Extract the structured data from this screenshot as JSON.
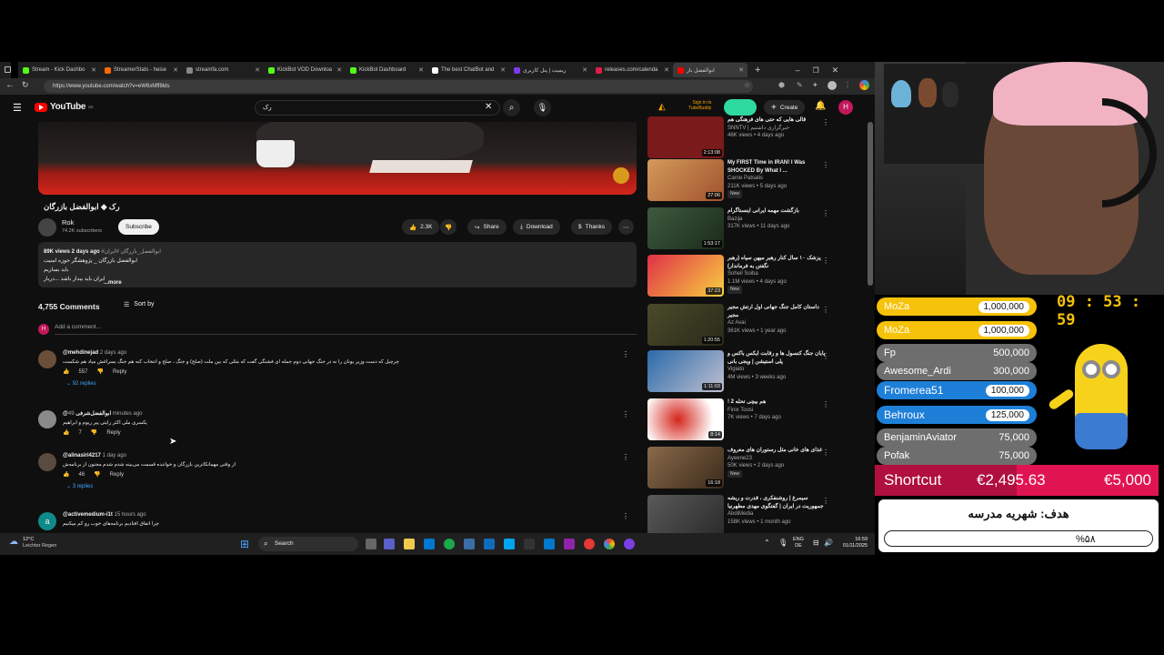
{
  "browser": {
    "tabs": [
      {
        "label": "Stream - Kick Dashbo",
        "color": "#53fc18"
      },
      {
        "label": "StreamerStats - heise",
        "color": "#ff6a00"
      },
      {
        "label": "streamfa.com",
        "color": "#888888"
      },
      {
        "label": "KickBot VOD Downloa",
        "color": "#53fc18"
      },
      {
        "label": "KickBot Dashboard",
        "color": "#53fc18"
      },
      {
        "label": "The best ChatBot and",
        "color": "#ffffff"
      },
      {
        "label": "ریمیت | پنل کاربری",
        "color": "#7c3aed"
      },
      {
        "label": "releases.com/calenda",
        "color": "#e11d48"
      },
      {
        "label": "ابوالفضل باز",
        "color": "#ff0000",
        "active": true
      }
    ],
    "url": "https://www.youtube.com/watch?v=eW6xMff8lds"
  },
  "youtube": {
    "logo_text": "YouTube",
    "logo_region": "DE",
    "search_value": "رک",
    "sign_in_lines": [
      "Sign in to",
      "TubeBuddy"
    ],
    "create_label": "Create",
    "profile_letter": "H",
    "video_title": "رک ◆ ابوالفضل بازرگان",
    "channel": {
      "name": "Rok",
      "subscribers": "74.2K subscribers",
      "subscribe_label": "Subscribe"
    },
    "actions": {
      "likes": "2.3K",
      "share": "Share",
      "download": "Download",
      "thanks": "Thanks"
    },
    "description": {
      "stats": "89K views  2 days ago",
      "tags": "#ابوالفضل_بازرگان #ایران",
      "lines": [
        "ابوالفضل بازرگان _ پژوهشگر حوزه امنیت",
        "باید بسازیم",
        "ایران باید بیدار باشد ...دربار"
      ],
      "more": "...more"
    },
    "comments": {
      "count": "4,755 Comments",
      "sort_label": "Sort by",
      "add_placeholder": "Add a comment...",
      "items": [
        {
          "author": "@mehdinejad",
          "time": "2 days ago",
          "text": "چرچیل که دست وزیر یونان را نه در جنگ جهانی دوم جمله ای فشنگی گفت که مثلی که بین ملت (صلح) و جنگ ، صلح و انتخاب کنه هم جنگ بسراغش میاد هم شکست",
          "likes": "557",
          "reply": "Reply",
          "replies": "92 replies",
          "avatar_color": "#6b4f3a"
        },
        {
          "author": "@ابوالفضل‌شرفی",
          "time": "49 minutes ago",
          "text": "یکسری ملی اکثر رایتی پیر ریوم و ابراهیم",
          "likes": "7",
          "reply": "Reply",
          "replies": "",
          "avatar_color": "#8a8a8a"
        },
        {
          "author": "@alinasiri4217",
          "time": "1 day ago",
          "text": "از وقتی مهمانکاترین بازرگان و خواننده قسمت می‌بینه شدم شدم مجنون از برنامه‌ش",
          "likes": "46",
          "reply": "Reply",
          "replies": "3 replies",
          "avatar_color": "#5a4a40"
        },
        {
          "author": "@activemedium-i1t",
          "time": "15 hours ago",
          "text": "چرا اتفاق افتادیم برنامه‌های خوب رو کم میکنیم",
          "likes": "",
          "reply": "",
          "replies": "",
          "avatar_color": "#0f8a8a"
        }
      ]
    },
    "recommendations": [
      {
        "title": "قالی هایی که حتی های فرهنگی هم",
        "channel": "SNNTV | خبرگزاری داشتیم",
        "stats": "46K views • 4 days ago",
        "duration": "2:13:08",
        "badge": "",
        "thumb": "#7a1a1a"
      },
      {
        "title": "My FIRST Time in IRAN! I Was SHOCKED By What I ...",
        "channel": "Carrie Patsalis",
        "stats": "211K views • 5 days ago",
        "duration": "27:06",
        "badge": "New",
        "thumb": "#b8753a"
      },
      {
        "title": "بازگشت مهمه ایرانی اینستاگرام",
        "channel": "Bazija",
        "stats": "317K views • 11 days ago",
        "duration": "1:53:17",
        "badge": "",
        "thumb": "#2e3e2e"
      },
      {
        "title": "پزشک ۱۰ سال کنار رهبر میهن سپاه (رهبر نگفتن به فرماندار)",
        "channel": "Soheil Soiba",
        "stats": "1.1M views • 4 days ago",
        "duration": "37:23",
        "badge": "New",
        "thumb": "#c0283a"
      },
      {
        "title": "داستان کامل جنگ جهانی اول ارتش مجیر مجیر",
        "channel": "Az Avai",
        "stats": "361K views • 1 year ago",
        "duration": "1:20:55",
        "badge": "",
        "thumb": "#3a3a22"
      },
      {
        "title": "پایان جنگ کنسول ها و رقابت ایکس باکس و پلی استیشن | ویجی بانی",
        "channel": "Vigiato",
        "stats": "4M views • 3 weeks ago",
        "duration": "1:11:03",
        "badge": "",
        "thumb": "#2a4a6a"
      },
      {
        "title": "! 2 هم بیچی تحله",
        "channel": "Finix Toosi",
        "stats": "7K views • 7 days ago",
        "duration": "8:14",
        "badge": "",
        "thumb": "#c7261c"
      },
      {
        "title": "غذای های خانی مثل رستوران های معروف",
        "channel": "Ayeene23",
        "stats": "50K views • 2 days ago",
        "duration": "16:18",
        "badge": "New",
        "thumb": "#6a4a3a"
      },
      {
        "title": "سیمرغ | روشنفکری ، قدرت و ریشه جمهوریت در ایران | گفتگوی مهدی مطهرنیا",
        "channel": "AbdiMedia",
        "stats": "158K views • 1 month ago",
        "duration": "",
        "badge": "",
        "thumb": "#3a3a3a"
      }
    ]
  },
  "taskbar": {
    "weather_temp": "12°C",
    "weather_desc": "Leichter Regen",
    "search_label": "Search",
    "lang_top": "ENG",
    "lang_bottom": "DE",
    "time": "16:59",
    "date": "01/11/2025"
  },
  "overlay": {
    "timer": "09 : 53 : 59",
    "leaderboard": [
      {
        "name": "MoZa",
        "amount": "1,000,000",
        "style": "gold"
      },
      {
        "name": "MoZa",
        "amount": "1,000,000",
        "style": "gold"
      },
      {
        "name": "Fp",
        "amount": "500,000",
        "style": "gray"
      },
      {
        "name": "Awesome_Ardi",
        "amount": "300,000",
        "style": "gray"
      },
      {
        "name": "Fromerea51",
        "amount": "100,000",
        "style": "blue"
      },
      {
        "name": "Behroux",
        "amount": "125,000",
        "style": "blue"
      },
      {
        "name": "BenjaminAviator",
        "amount": "75,000",
        "style": "gray"
      },
      {
        "name": "Pofak",
        "amount": "75,000",
        "style": "gray"
      }
    ],
    "shortcut_label": "Shortcut",
    "shortcut_current": "€2,495.63",
    "shortcut_goal": "€5,000",
    "shortcut_progress": 0.499,
    "goal_title": "هدف: شهریه مدرسه",
    "goal_percent": "%۵۸",
    "goal_progress": 0.58,
    "colors": {
      "gold": "#f6c20a",
      "blue": "#1e7fd8",
      "gray": "#6e6e6e",
      "shortcut": "#e11452"
    }
  }
}
